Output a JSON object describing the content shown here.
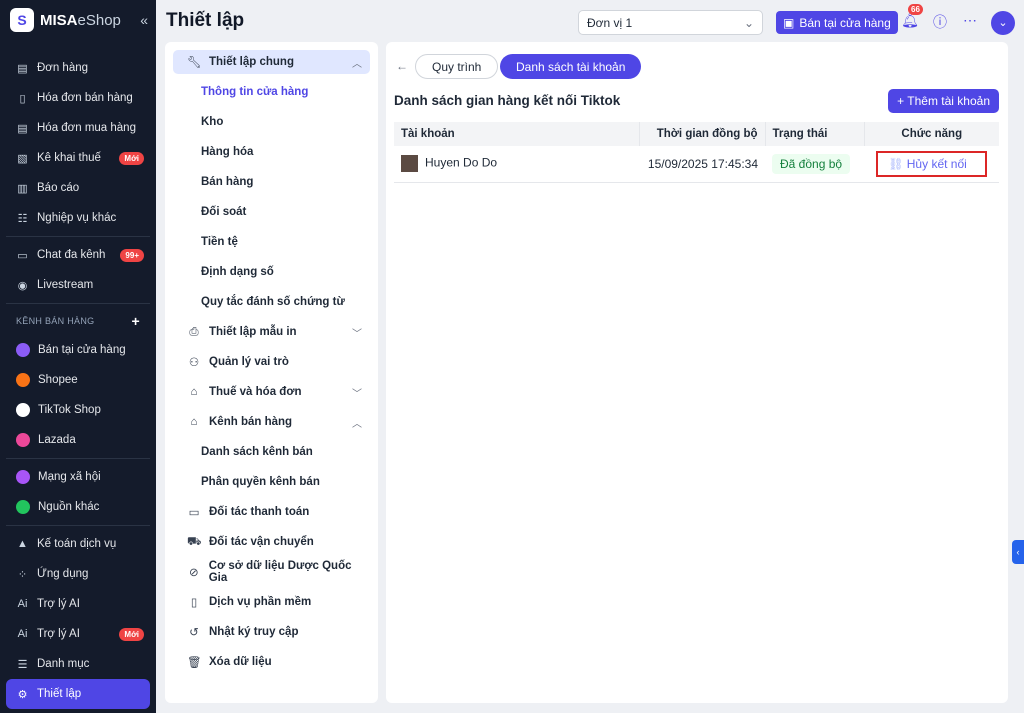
{
  "brand": {
    "logo_text": "MISA",
    "logo_suffix": "eShop"
  },
  "sidebar": {
    "group1": [
      {
        "label": "Đơn hàng",
        "icon": "order-icon"
      },
      {
        "label": "Hóa đơn bán hàng",
        "icon": "invoice-icon"
      },
      {
        "label": "Hóa đơn mua hàng",
        "icon": "purchase-invoice-icon"
      },
      {
        "label": "Kê khai thuế",
        "icon": "tax-icon",
        "badge": "Mới"
      },
      {
        "label": "Báo cáo",
        "icon": "report-icon"
      },
      {
        "label": "Nghiệp vụ khác",
        "icon": "list-icon"
      }
    ],
    "group2": [
      {
        "label": "Chat đa kênh",
        "icon": "chat-icon",
        "badge": "99+"
      },
      {
        "label": "Livestream",
        "icon": "livestream-icon"
      }
    ],
    "channels_header": "KÊNH BÁN HÀNG",
    "channels": [
      {
        "label": "Bán tại cửa hàng",
        "color": "#8b5cf6"
      },
      {
        "label": "Shopee",
        "color": "#f97316"
      },
      {
        "label": "TikTok Shop",
        "color": "#ffffff"
      },
      {
        "label": "Lazada",
        "color": "#ec4899"
      }
    ],
    "group3": [
      {
        "label": "Mạng xã hội",
        "color": "#a855f7"
      },
      {
        "label": "Nguồn khác",
        "color": "#22c55e"
      }
    ],
    "group4": [
      {
        "label": "Kế toán dịch vụ",
        "icon": "accounting-icon"
      },
      {
        "label": "Ứng dụng",
        "icon": "apps-icon"
      },
      {
        "label": "Trợ lý AI",
        "icon": "ai-icon"
      },
      {
        "label": "Trợ lý AI",
        "icon": "ai-icon",
        "badge": "Mới"
      },
      {
        "label": "Danh mục",
        "icon": "menu-icon"
      }
    ],
    "active": "Thiết lập"
  },
  "header": {
    "title": "Thiết lập",
    "unit": "Đơn vị 1",
    "shop_button": "Bán tại cửa hàng",
    "notifications": "66"
  },
  "settings_menu": {
    "general": "Thiết lập chung",
    "general_items": [
      "Thông tin cửa hàng",
      "Kho",
      "Hàng hóa",
      "Bán hàng",
      "Đối soát",
      "Tiền tệ",
      "Định dạng số",
      "Quy tắc đánh số chứng từ"
    ],
    "print": "Thiết lập mẫu in",
    "roles": "Quản lý vai trò",
    "tax": "Thuế và hóa đơn",
    "channels": "Kênh bán hàng",
    "channel_items": [
      "Danh sách kênh bán",
      "Phân quyền kênh bán"
    ],
    "others": [
      "Đối tác thanh toán",
      "Đối tác vận chuyển",
      "Cơ sở dữ liệu Dược Quốc Gia",
      "Dịch vụ phần mềm",
      "Nhật ký truy cập",
      "Xóa dữ liệu"
    ]
  },
  "main": {
    "tabs": [
      "Quy trình",
      "Danh sách tài khoản"
    ],
    "active_tab": "Danh sách tài khoản",
    "heading": "Danh sách gian hàng kết nối Tiktok",
    "add_button": "+ Thêm tài khoản",
    "columns": [
      "Tài khoản",
      "Thời gian đồng bộ",
      "Trạng thái",
      "Chức năng"
    ],
    "rows": [
      {
        "account": "Huyen Do Do",
        "sync_time": "15/09/2025 17:45:34",
        "status": "Đã đồng bộ",
        "action": "Hủy kết nối"
      }
    ]
  },
  "colors": {
    "accent": "#4f46e5",
    "sidebar_bg": "#141b2b",
    "badge": "#ef4444"
  }
}
